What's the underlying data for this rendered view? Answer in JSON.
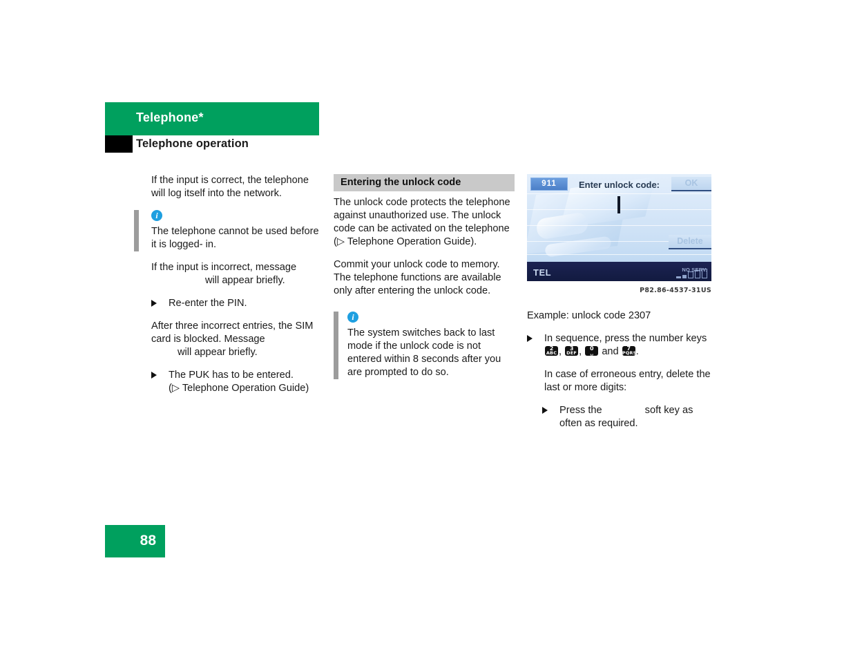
{
  "header": {
    "chapter": "Telephone*",
    "section": "Telephone operation"
  },
  "left_column": {
    "para1": "If the input is correct, the telephone will log itself into the network.",
    "note1": "The telephone cannot be used before it is logged- in.",
    "para2_a": "If the input is incorrect, message",
    "para2_b": "will appear briefly.",
    "bullet1": "Re-enter the PIN.",
    "para3_a": "After three incorrect entries, the SIM card is blocked. Message",
    "para3_b": "will appear briefly.",
    "bullet2": "The PUK has to be entered.",
    "bullet2_sub": "(▷ Telephone Operation Guide)"
  },
  "middle_column": {
    "heading": "Entering the unlock code",
    "para1": "The unlock code protects the telephone against unauthorized use. The unlock code can be activated on the telephone (▷ Telephone Operation Guide).",
    "para2": "Commit your unlock code to memory. The telephone functions are available only after entering the unlock code.",
    "note1": "The system switches back to last mode if the unlock code is not entered within 8 seconds after you are prompted to do so."
  },
  "right_column": {
    "display": {
      "emergency_label": "911",
      "prompt": "Enter unlock code:",
      "softkey_ok": "OK",
      "softkey_delete": "Delete",
      "mode_label": "TEL",
      "service_status": "NO SERV."
    },
    "caption": "P82.86-4537-31US",
    "example": "Example: unlock code 2307",
    "bullet1_a": "In sequence, press the number keys",
    "bullet1_sep1": ",",
    "bullet1_sep2": ",",
    "bullet1_and": "and",
    "bullet1_end": ".",
    "keys": [
      {
        "digit": "2",
        "letters": "ABC"
      },
      {
        "digit": "3",
        "letters": "DEF"
      },
      {
        "digit": "0",
        "letters": "␣"
      },
      {
        "digit": "7",
        "letters": "PQRS"
      }
    ],
    "para1": "In case of erroneous entry, delete the last or more digits:",
    "bullet2_a": "Press the",
    "bullet2_b": "soft key as often as required."
  },
  "footer": {
    "page_number": "88"
  },
  "colors": {
    "brand_green": "#00a05e",
    "info_blue": "#1e9fe0",
    "subhead_gray": "#c9c9c9",
    "note_bar_gray": "#9c9c9c"
  }
}
